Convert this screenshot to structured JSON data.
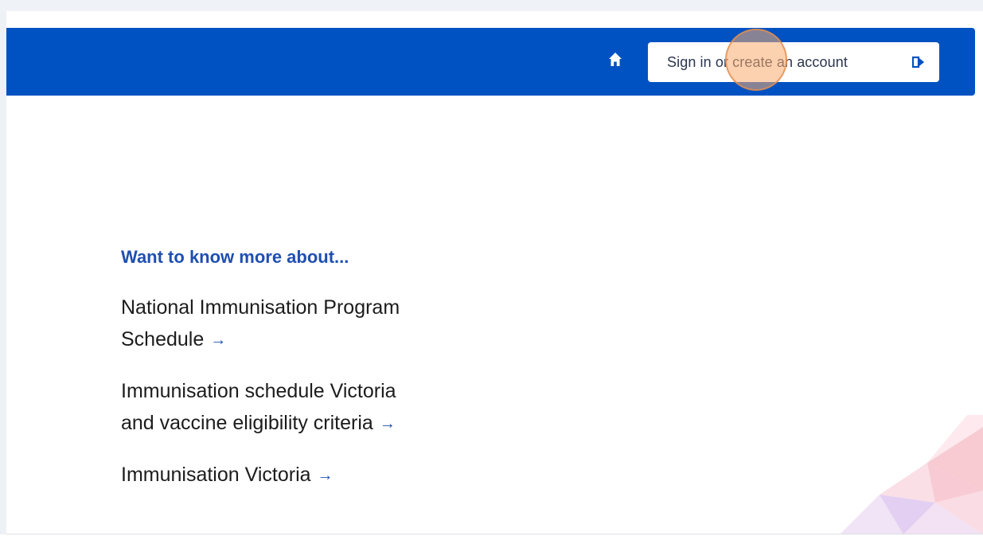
{
  "header": {
    "signin_label": "Sign in or create an account",
    "home_icon": "home-icon",
    "signin_icon": "sign-in-arrow-icon"
  },
  "links_section": {
    "heading": "Want to know more about...",
    "items": [
      {
        "line1": "National Immunisation Program",
        "line2": "Schedule"
      },
      {
        "line1": "Immunisation schedule Victoria",
        "line2": "and vaccine eligibility criteria"
      },
      {
        "line1": "",
        "line2": "Immunisation Victoria"
      }
    ],
    "arrow_glyph": "→"
  },
  "colors": {
    "header_blue": "#0052c2",
    "link_arrow_blue": "#1f4fb0",
    "heading_blue": "#1f4fb0",
    "text_dark": "#1c1c1c"
  }
}
